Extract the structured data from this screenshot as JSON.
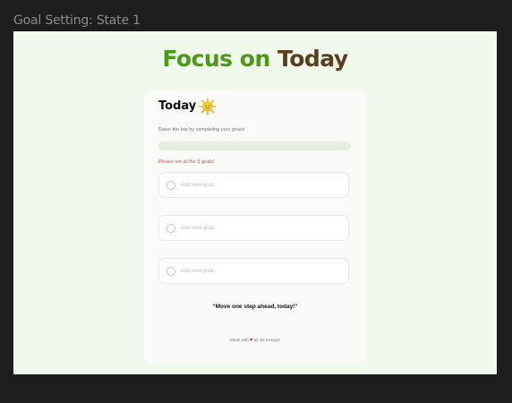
{
  "frame_label": "Goal Setting: State 1",
  "hero": {
    "part1": "Focus on",
    "part2": "Today"
  },
  "card": {
    "title": "Today",
    "title_icon": "sun-icon",
    "subtitle": "Raise the bar by completing your goals!",
    "progress": 0,
    "error": "Please set all the 3 goals!",
    "goals": [
      {
        "value": "",
        "placeholder": "Add new goal..."
      },
      {
        "value": "",
        "placeholder": "Add new goal..."
      },
      {
        "value": "",
        "placeholder": "Add new goal..."
      }
    ],
    "quote": "“Move one step ahead, today!”",
    "footer": {
      "prefix": "Made with",
      "heart": "❤",
      "suffix": "by Jul Kostyun"
    }
  },
  "colors": {
    "accent_green": "#4a9a14",
    "accent_brown": "#5a3e1b",
    "error_red": "#e5484d",
    "frame_bg": "#f1f9ec"
  }
}
